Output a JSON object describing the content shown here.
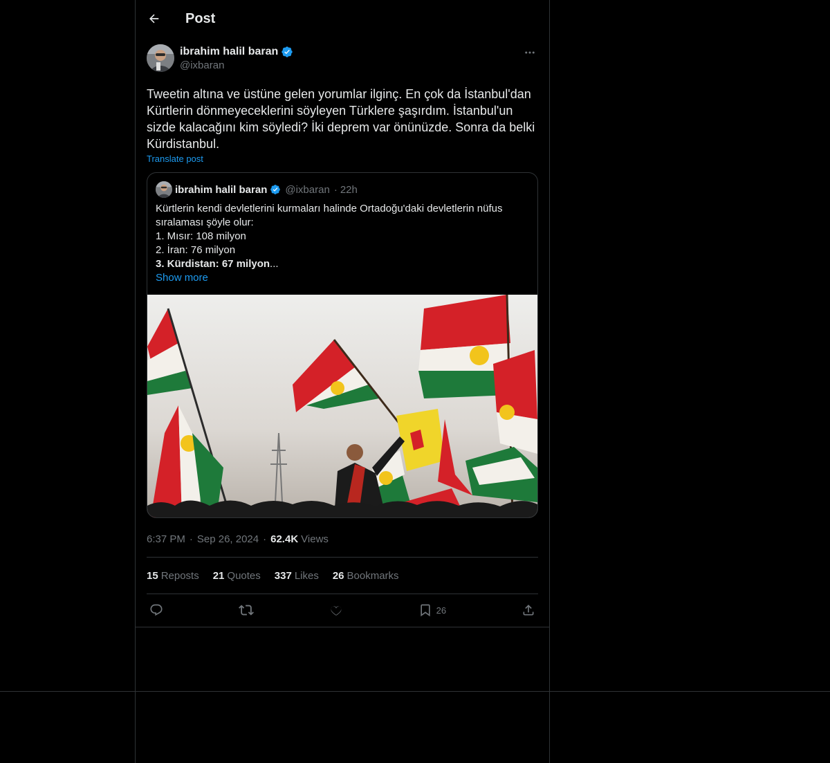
{
  "header": {
    "title": "Post"
  },
  "post": {
    "author_name": "ibrahim halil baran",
    "author_handle": "@ixbaran",
    "text": "Tweetin altına ve üstüne gelen yorumlar ilginç. En çok da İstanbul'dan Kürtlerin dönmeyeceklerini söyleyen Türklere şaşırdım. İstanbul'un sizde kalacağını kim söyledi? İki deprem var önünüzde. Sonra da belki Kürdistanbul.",
    "translate_label": "Translate post",
    "time": "6:37 PM",
    "date": "Sep 26, 2024",
    "views_count": "62.4K",
    "views_label": "Views"
  },
  "quote": {
    "author_name": "ibrahim halil baran",
    "author_handle": "@ixbaran",
    "time_ago": "22h",
    "lines": [
      "Kürtlerin kendi devletlerini kurmaları halinde Ortadoğu'daki devletlerin nüfus sıralaması şöyle olur:",
      "1. Mısır: 108 milyon",
      "2. İran: 76 milyon"
    ],
    "bold_line": "3. Kürdistan: 67 milyon",
    "ellipsis": "...",
    "show_more": "Show more"
  },
  "stats": {
    "reposts_count": "15",
    "reposts_label": "Reposts",
    "quotes_count": "21",
    "quotes_label": "Quotes",
    "likes_count": "337",
    "likes_label": "Likes",
    "bookmarks_count": "26",
    "bookmarks_label": "Bookmarks"
  },
  "actions": {
    "bookmark_count": "26"
  },
  "colors": {
    "accent": "#1d9bf0",
    "muted": "#71767b",
    "border": "#2f3336",
    "background": "#000000"
  },
  "icons": [
    "back-arrow-icon",
    "verified-badge-icon",
    "more-icon",
    "reply-icon",
    "repost-icon",
    "like-icon",
    "bookmark-icon",
    "share-icon"
  ]
}
